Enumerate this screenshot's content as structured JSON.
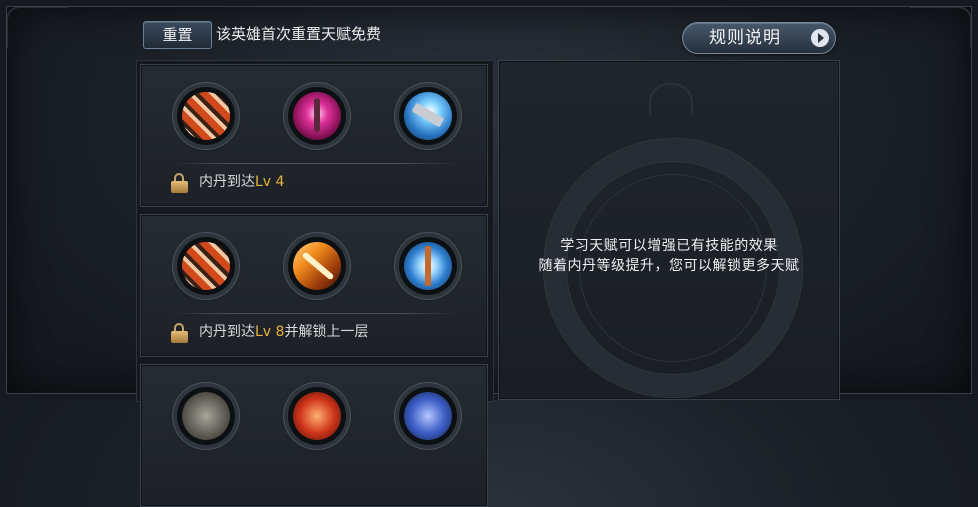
{
  "header": {
    "reset_button": "重置",
    "free_reset_text": "该英雄首次重置天赋免费",
    "rules_button": "规则说明"
  },
  "tiers": [
    {
      "skills": [
        {
          "icon": "flame-armor-skill-icon"
        },
        {
          "icon": "pink-sword-skill-icon"
        },
        {
          "icon": "lightning-blade-skill-icon"
        }
      ],
      "requirement": {
        "prefix": "内丹到达",
        "lv": "Lv 4",
        "suffix": ""
      }
    },
    {
      "skills": [
        {
          "icon": "flame-armor-skill-icon"
        },
        {
          "icon": "fire-slash-skill-icon"
        },
        {
          "icon": "ice-sword-skill-icon"
        }
      ],
      "requirement": {
        "prefix": "内丹到达",
        "lv": "Lv 8",
        "suffix": "并解锁上一层"
      }
    },
    {
      "skills": [
        {
          "icon": "grey-skill-icon"
        },
        {
          "icon": "red-skill-icon"
        },
        {
          "icon": "blue-skill-icon"
        }
      ]
    }
  ],
  "description": {
    "line1": "学习天赋可以增强已有技能的效果",
    "line2": "随着内丹等级提升，您可以解锁更多天赋"
  }
}
